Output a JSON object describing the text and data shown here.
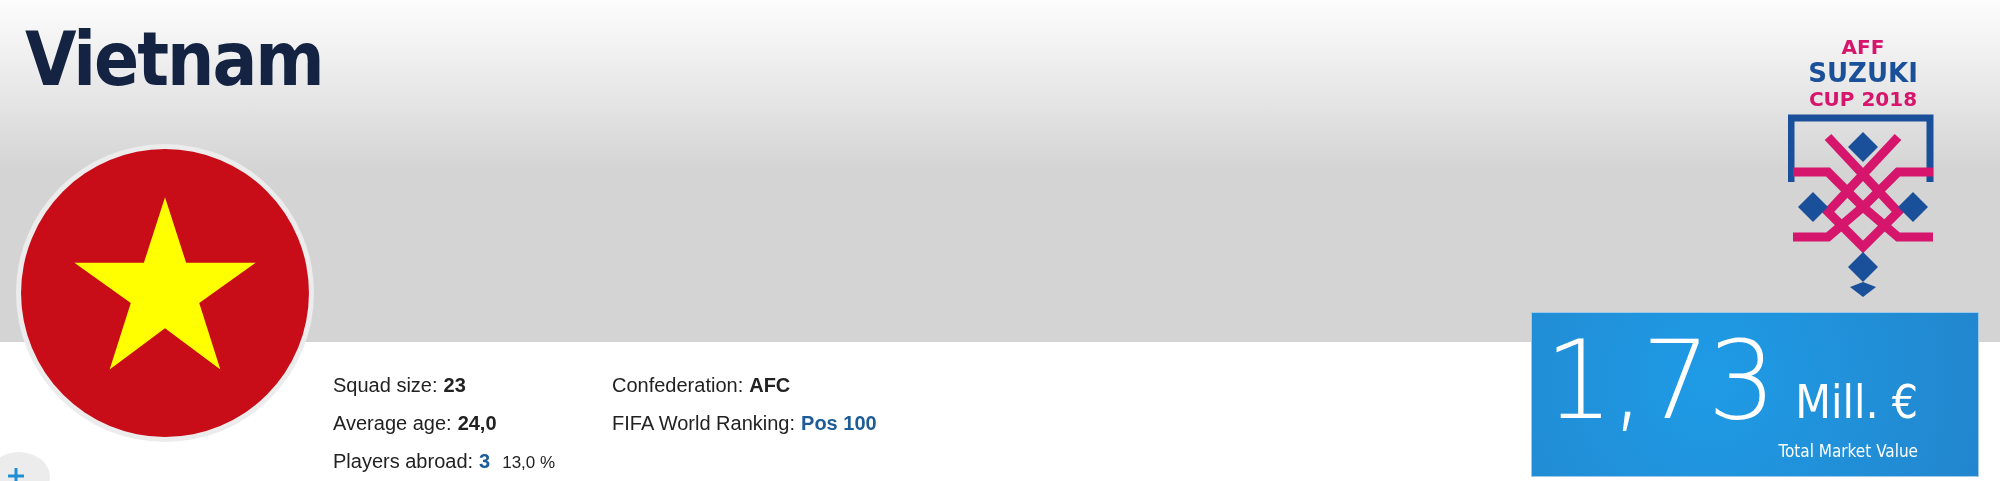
{
  "team": {
    "name": "Vietnam"
  },
  "logo": {
    "lines": [
      "AFF",
      "SUZUKI",
      "CUP 2018"
    ]
  },
  "stats": [
    [
      {
        "label": "Squad size:",
        "value": "23",
        "kind": "bold"
      },
      {
        "label": "Average age:",
        "value": "24,0",
        "kind": "bold"
      },
      {
        "label": "Players abroad:",
        "value": "3",
        "kind": "link",
        "note": "13,0 %"
      }
    ],
    [
      {
        "label": "Confederation:",
        "value": "AFC",
        "kind": "bold"
      },
      {
        "label": "FIFA World Ranking:",
        "value": "Pos 100",
        "kind": "link"
      }
    ]
  ],
  "market_value": {
    "amount": "1,73",
    "unit": "Mill. €",
    "caption": "Total Market Value"
  }
}
